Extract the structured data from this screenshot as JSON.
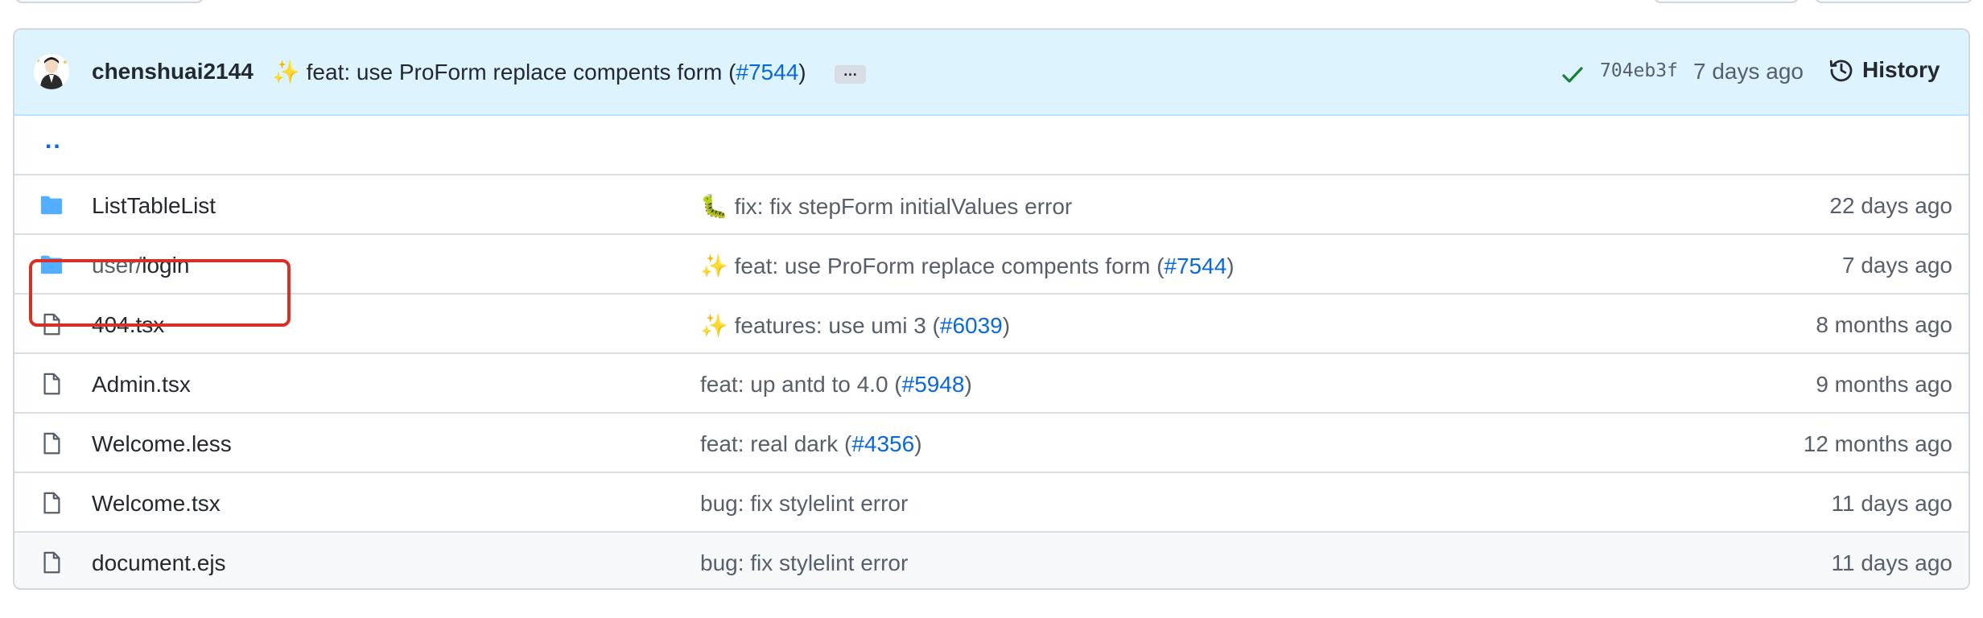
{
  "header": {
    "author": "chenshuai2144",
    "sparkle": "✨",
    "commit_prefix": " feat: use ProForm replace compents form (",
    "commit_pr": "#7544",
    "commit_suffix": ")",
    "ellipsis": "…",
    "sha": "704eb3f",
    "age": "7 days ago",
    "history_label": "History",
    "check_color": "#1a7f37"
  },
  "parent_link": "..",
  "rows": [
    {
      "type": "folder",
      "name_prefix": "",
      "name": "ListTableList",
      "emoji": "🐛",
      "msg_prefix": " fix: fix stepForm initialValues error",
      "pr": "",
      "msg_suffix": "",
      "age": "22 days ago"
    },
    {
      "type": "folder",
      "name_prefix": "user/",
      "name": "login",
      "emoji": "✨",
      "msg_prefix": " feat: use ProForm replace compents form (",
      "pr": "#7544",
      "msg_suffix": ")",
      "age": "7 days ago"
    },
    {
      "type": "file",
      "name_prefix": "",
      "name": "404.tsx",
      "emoji": "✨",
      "msg_prefix": " features: use umi 3 (",
      "pr": "#6039",
      "msg_suffix": ")",
      "age": "8 months ago"
    },
    {
      "type": "file",
      "name_prefix": "",
      "name": "Admin.tsx",
      "emoji": "",
      "msg_prefix": "feat: up antd to 4.0 (",
      "pr": "#5948",
      "msg_suffix": ")",
      "age": "9 months ago"
    },
    {
      "type": "file",
      "name_prefix": "",
      "name": "Welcome.less",
      "emoji": "",
      "msg_prefix": "feat: real dark (",
      "pr": "#4356",
      "msg_suffix": ")",
      "age": "12 months ago"
    },
    {
      "type": "file",
      "name_prefix": "",
      "name": "Welcome.tsx",
      "emoji": "",
      "msg_prefix": "bug: fix stylelint error",
      "pr": "",
      "msg_suffix": "",
      "age": "11 days ago"
    },
    {
      "type": "file",
      "name_prefix": "",
      "name": "document.ejs",
      "emoji": "",
      "msg_prefix": "bug: fix stylelint error",
      "pr": "",
      "msg_suffix": "",
      "age": "11 days ago"
    }
  ],
  "colors": {
    "link": "#0969da",
    "folder": "#54aeff",
    "file": "#57606a",
    "highlight": "#d93025"
  }
}
